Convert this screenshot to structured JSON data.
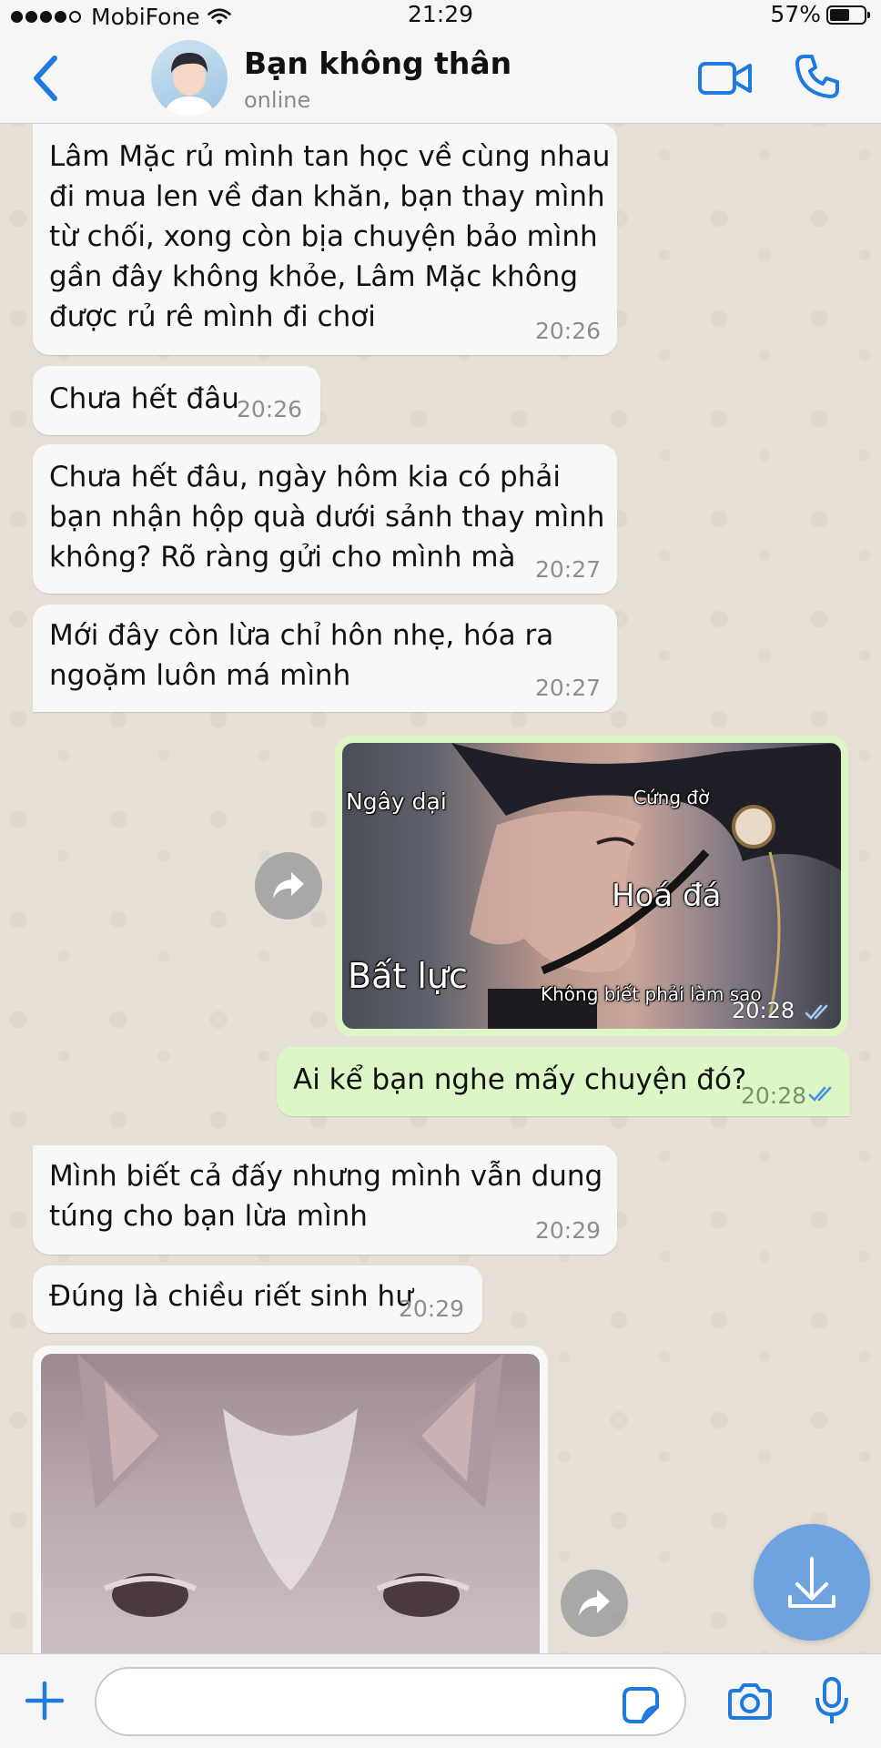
{
  "status_bar": {
    "carrier": "MobiFone",
    "time": "21:29",
    "battery": "57%"
  },
  "header": {
    "contact_name": "Bạn không thân",
    "contact_status": "online"
  },
  "messages": [
    {
      "direction": "incoming",
      "text_lines": [
        "Lâm Mặc rủ mình tan học về cùng nhau",
        "đi mua len về đan khăn, bạn thay mình",
        "từ chối, xong còn bịa chuyện bảo mình",
        "gần đây không khỏe, Lâm Mặc không",
        "được rủ rê mình đi chơi"
      ],
      "time": "20:26"
    },
    {
      "direction": "incoming",
      "text_lines": [
        "Chưa hết đâu"
      ],
      "time": "20:26"
    },
    {
      "direction": "incoming",
      "text_lines": [
        "Chưa hết đâu, ngày hôm kia có phải",
        "bạn nhận hộp quà dưới sảnh thay mình",
        "không? Rõ ràng gửi cho mình mà"
      ],
      "time": "20:27"
    },
    {
      "direction": "incoming",
      "text_lines": [
        "Mới đây còn lừa chỉ hôn nhẹ, hóa ra",
        "ngoặm luôn má mình"
      ],
      "time": "20:27"
    },
    {
      "direction": "outgoing",
      "type": "image",
      "image_captions": [
        "Ngây dại",
        "Cứng đờ",
        "Hoá đá",
        "Bất lực",
        "Không biết phải làm sao"
      ],
      "time": "20:28",
      "read": true
    },
    {
      "direction": "outgoing",
      "text_lines": [
        "Ai kể bạn nghe mấy chuyện đó?"
      ],
      "time": "20:28",
      "read": true
    },
    {
      "direction": "incoming",
      "text_lines": [
        "Mình biết cả đấy nhưng mình vẫn dung",
        "túng cho bạn lừa mình"
      ],
      "time": "20:29"
    },
    {
      "direction": "incoming",
      "text_lines": [
        "Đúng là chiều riết sinh hư"
      ],
      "time": "20:29"
    },
    {
      "direction": "incoming",
      "type": "image"
    }
  ],
  "icons": {
    "back": "chevron-left-icon",
    "video_call": "video-camera-icon",
    "voice_call": "phone-icon",
    "forward": "forward-arrow-icon",
    "scroll_down": "download-arrow-icon",
    "attach": "plus-icon",
    "sticker": "sticker-icon",
    "camera": "camera-icon",
    "microphone": "microphone-icon"
  },
  "colors": {
    "accent": "#1f7ae0",
    "outgoing_bubble": "#dcf7c5",
    "incoming_bubble": "#f8f8f8",
    "read_ticks": "#4a90e2",
    "chat_background": "#e6dfd5"
  }
}
